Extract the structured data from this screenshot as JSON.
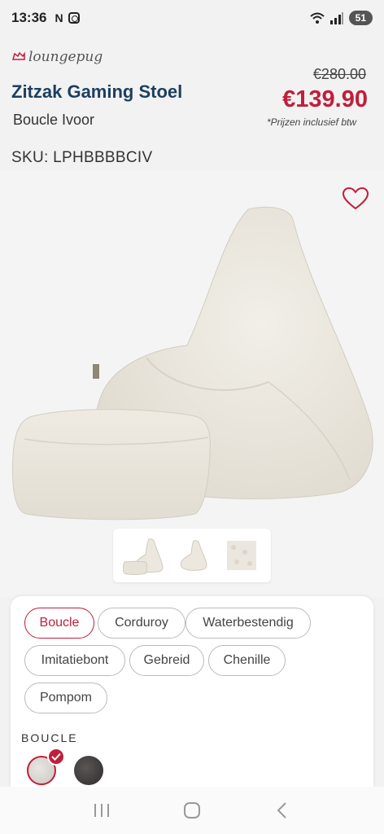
{
  "status_bar": {
    "time": "13:36",
    "notification_letter": "N",
    "battery": "51",
    "icons": [
      "instagram-icon",
      "wifi-icon",
      "signal-icon"
    ]
  },
  "header": {
    "brand": "loungepug",
    "title": "Zitzak Gaming Stoel",
    "variant": "Boucle Ivoor",
    "old_price": "€280.00",
    "new_price": "€139.90",
    "price_note": "*Prijzen inclusief btw",
    "sku": "SKU: LPHBBBBCIV"
  },
  "gallery": {
    "thumbnail_count": 3,
    "favorite_icon": "heart-icon"
  },
  "options": {
    "fabrics": [
      {
        "label": "Boucle",
        "active": true
      },
      {
        "label": "Corduroy",
        "active": false
      },
      {
        "label": "Waterbestendig",
        "active": false
      },
      {
        "label": "Imitatiebont",
        "active": false
      },
      {
        "label": "Gebreid",
        "active": false
      },
      {
        "label": "Chenille",
        "active": false
      },
      {
        "label": "Pompom",
        "active": false
      }
    ],
    "color_label": "BOUCLE"
  },
  "colors": {
    "accent": "#c01f3a",
    "title": "#1c3f5e"
  }
}
